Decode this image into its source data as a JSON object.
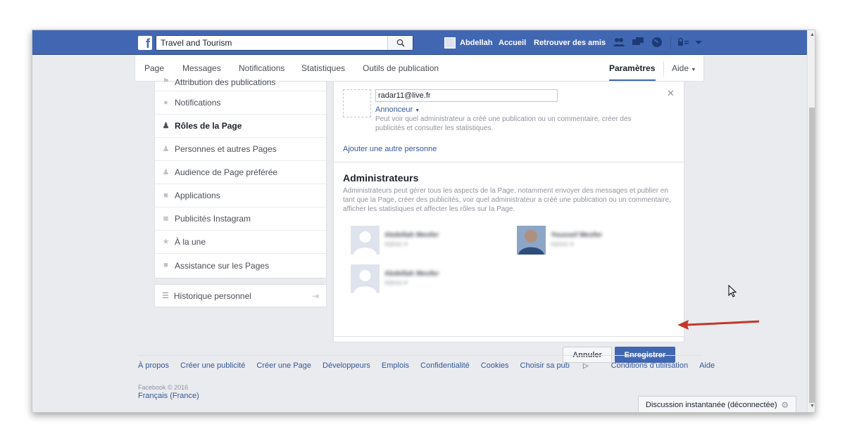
{
  "topbar": {
    "search_value": "Travel and Tourism",
    "user_name": "Abdellah",
    "home": "Accueil",
    "find_friends": "Retrouver des amis"
  },
  "tabs": [
    {
      "label": "Page"
    },
    {
      "label": "Messages"
    },
    {
      "label": "Notifications"
    },
    {
      "label": "Statistiques"
    },
    {
      "label": "Outils de publication"
    },
    {
      "label": "Paramètres"
    },
    {
      "label": "Aide"
    }
  ],
  "sidebar": {
    "items": [
      {
        "label": "Attribution des publications"
      },
      {
        "label": "Notifications"
      },
      {
        "label": "Rôles de la Page"
      },
      {
        "label": "Personnes et autres Pages"
      },
      {
        "label": "Audience de Page préférée"
      },
      {
        "label": "Applications"
      },
      {
        "label": "Publicités Instagram"
      },
      {
        "label": "À la une"
      },
      {
        "label": "Assistance sur les Pages"
      }
    ],
    "history": "Historique personnel"
  },
  "main": {
    "email_value": "radar11@live.fr",
    "role_label": "Annonceur",
    "role_desc": "Peut voir quel administrateur a créé une publication ou un commentaire, créer des publicités et consulter les statistiques.",
    "add_person": "Ajouter une autre personne",
    "admins_title": "Administrateurs",
    "admins_desc": "Administrateurs peut gérer tous les aspects de la Page, notamment envoyer des messages et publier en tant que la Page, créer des publicités, voir quel administrateur a créé une publication ou un commentaire, afficher les statistiques et affecter les rôles sur la Page.",
    "people": [
      {
        "name": "Abdellah Mesfer",
        "role": "Admin ▾"
      },
      {
        "name": "Youssef Mesfer",
        "role": "Admin ▾"
      },
      {
        "name": "Abdellah Mesfer",
        "role": "Admin ▾"
      }
    ],
    "cancel": "Annuler",
    "save": "Enregistrer"
  },
  "footer": {
    "links": [
      "À propos",
      "Créer une publicité",
      "Créer une Page",
      "Développeurs",
      "Emplois",
      "Confidentialité",
      "Cookies",
      "Choisir sa pub",
      "Conditions d’utilisation",
      "Aide"
    ],
    "copyright": "Facebook © 2016",
    "language": "Français (France)"
  },
  "chat": {
    "label": "Discussion instantanée (déconnectée)"
  },
  "colors": {
    "brand": "#4267b2",
    "link": "#365899",
    "arrow": "#c0392b"
  }
}
